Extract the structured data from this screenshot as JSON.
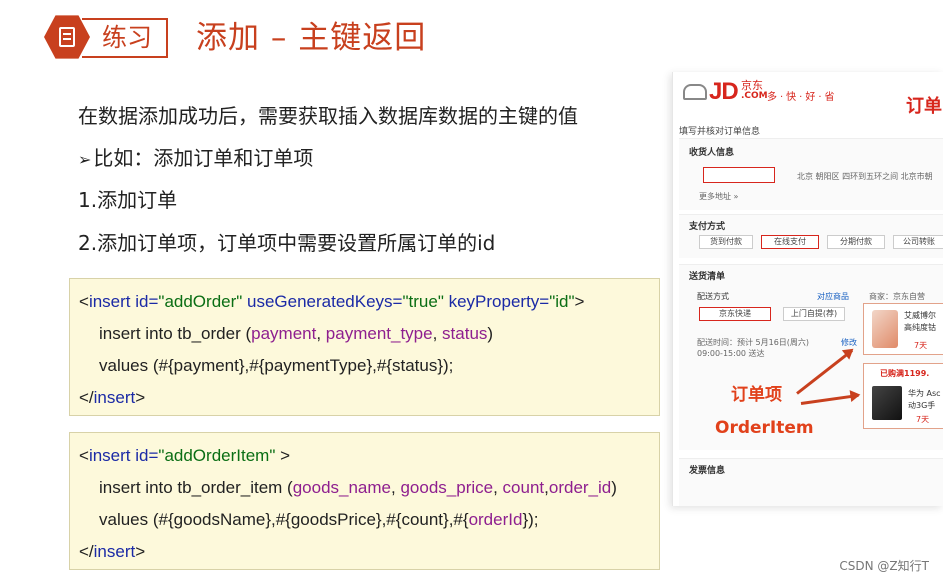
{
  "header": {
    "badge_label": "练习",
    "title": "添加 – 主键返回"
  },
  "content": {
    "line1": "在数据添加成功后，需要获取插入数据库数据的主键的值",
    "line2_marker": "➢",
    "line2": "比如：添加订单和订单项",
    "line3": "1.添加订单",
    "line4": "2.添加订单项，订单项中需要设置所属订单的id"
  },
  "code1": {
    "open_lt": "<",
    "tag": "insert",
    "id_attr": " id=",
    "id_val": "\"addOrder\"",
    "ugk_attr": " useGeneratedKeys=",
    "ugk_val": "\"true\"",
    "kp_attr": " keyProperty=",
    "kp_val": "\"id\"",
    "open_gt": ">",
    "l2_a": "insert into tb_order (",
    "l2_c1": "payment",
    "l2_sep1": ", ",
    "l2_c2": "payment_type",
    "l2_sep2": ", ",
    "l2_c3": "status",
    "l2_end": ")",
    "l3": "values (#{payment},#{paymentType},#{status});",
    "close_lt": "</",
    "close_tag": "insert",
    "close_gt": ">"
  },
  "code2": {
    "open_lt": "<",
    "tag": "insert",
    "id_attr": " id=",
    "id_val": "\"addOrderItem\"",
    "open_gt": " >",
    "l2_a": "insert into tb_order_item (",
    "l2_c1": "goods_name",
    "l2_sep1": ", ",
    "l2_c2": "goods_price",
    "l2_sep2": ", ",
    "l2_c3": "count",
    "l2_sep3": ",",
    "l2_c4": "order_id",
    "l2_end": ")",
    "l3_a": "values (#{goodsName},#{goodsPrice},#{count},#{",
    "l3_b": "orderId",
    "l3_c": "});",
    "close_lt": "</",
    "close_tag": "insert",
    "close_gt": ">"
  },
  "jd": {
    "logo": "JD",
    "logo_cn": "京东",
    "logo_com": ".COM",
    "slogan": "多·快·好·省",
    "order_title": "订单",
    "subtitle": "填写并核对订单信息",
    "recipient_heading": "收货人信息",
    "address": "北京 朝阳区 四环到五环之间 北京市朝",
    "more_address": "更多地址 »",
    "payment_heading": "支付方式",
    "pay_options": [
      "货到付款",
      "在线支付",
      "分期付款",
      "公司转账"
    ],
    "shipping_heading": "送货清单",
    "delivery_label": "配送方式",
    "matching_goods": "对应商品",
    "merchant": "商家：京东自营",
    "delivery_options": [
      "京东快递",
      "上门自提(荐)"
    ],
    "delivery_time": "配送时间：预计 5月16日(周六) 09:00-15:00 送达",
    "modify": "修改",
    "goods1_name": "艾威博尔",
    "goods1_desc": "高纯度钴",
    "goods1_tag": "7天",
    "goods2_promo": "已购满1199.",
    "goods2_name": "华为 Asc",
    "goods2_desc": "动3G手",
    "goods2_tag": "7天",
    "annot_item": "订单项",
    "annot_item_en": "OrderItem",
    "invoice_heading": "发票信息"
  },
  "watermark": "CSDN @Z知行T",
  "colors": {
    "accent": "#c8401e",
    "jd_red": "#d7261d",
    "code_bg": "#fdf9db",
    "code_tag": "#1b2aa6",
    "code_string": "#0a6e14",
    "code_column": "#8e1f8f"
  }
}
